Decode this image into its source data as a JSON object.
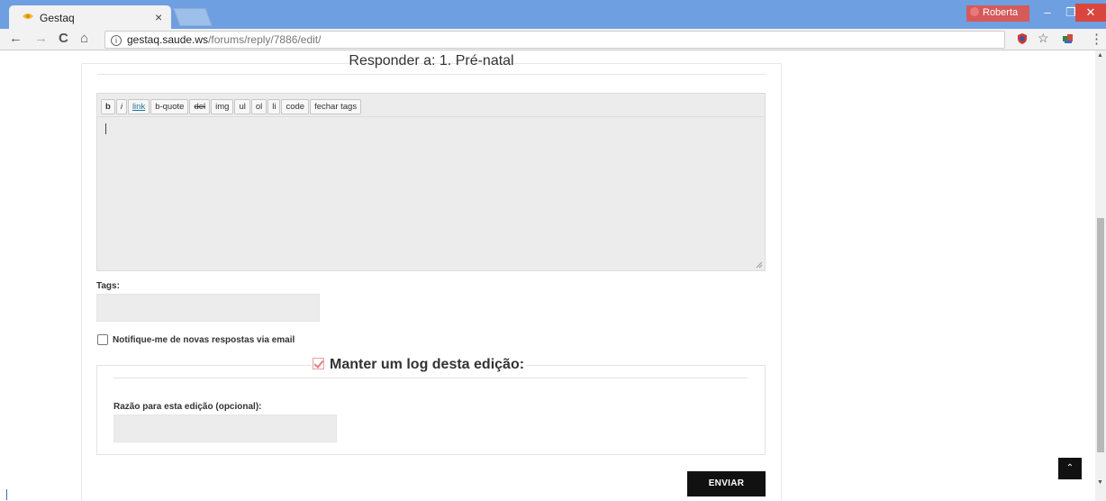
{
  "browser": {
    "tab_title": "Gestaq",
    "tab_close": "×",
    "profile_name": "Roberta",
    "url_host": "gestaq.saude.ws",
    "url_path": "/forums/reply/7886/edit/",
    "window": {
      "minimize": "–",
      "restore": "❐",
      "close": "✕"
    },
    "nav": {
      "back": "←",
      "forward": "→",
      "reload": "C",
      "home": "⌂"
    },
    "bookmark_star": "☆",
    "menu": "⋮"
  },
  "page": {
    "heading": "Responder a: 1. Pré-natal",
    "toolbar": [
      "b",
      "i",
      "link",
      "b-quote",
      "del",
      "img",
      "ul",
      "ol",
      "li",
      "code",
      "fechar tags"
    ],
    "tags_label": "Tags:",
    "tags_value": "",
    "notify_label": "Notifique-me de novas respostas via email",
    "log_label": "Manter um log desta edição:",
    "reason_label": "Razão para esta edição (opcional):",
    "reason_value": "",
    "submit_label": "ENVIAR",
    "to_top": "⌃"
  },
  "colors": {
    "titlebar": "#6e9fe0",
    "submit_bg": "#111111",
    "field_bg": "#ececec",
    "profile_bg": "#d65a5a",
    "close_btn": "#d9463e"
  }
}
